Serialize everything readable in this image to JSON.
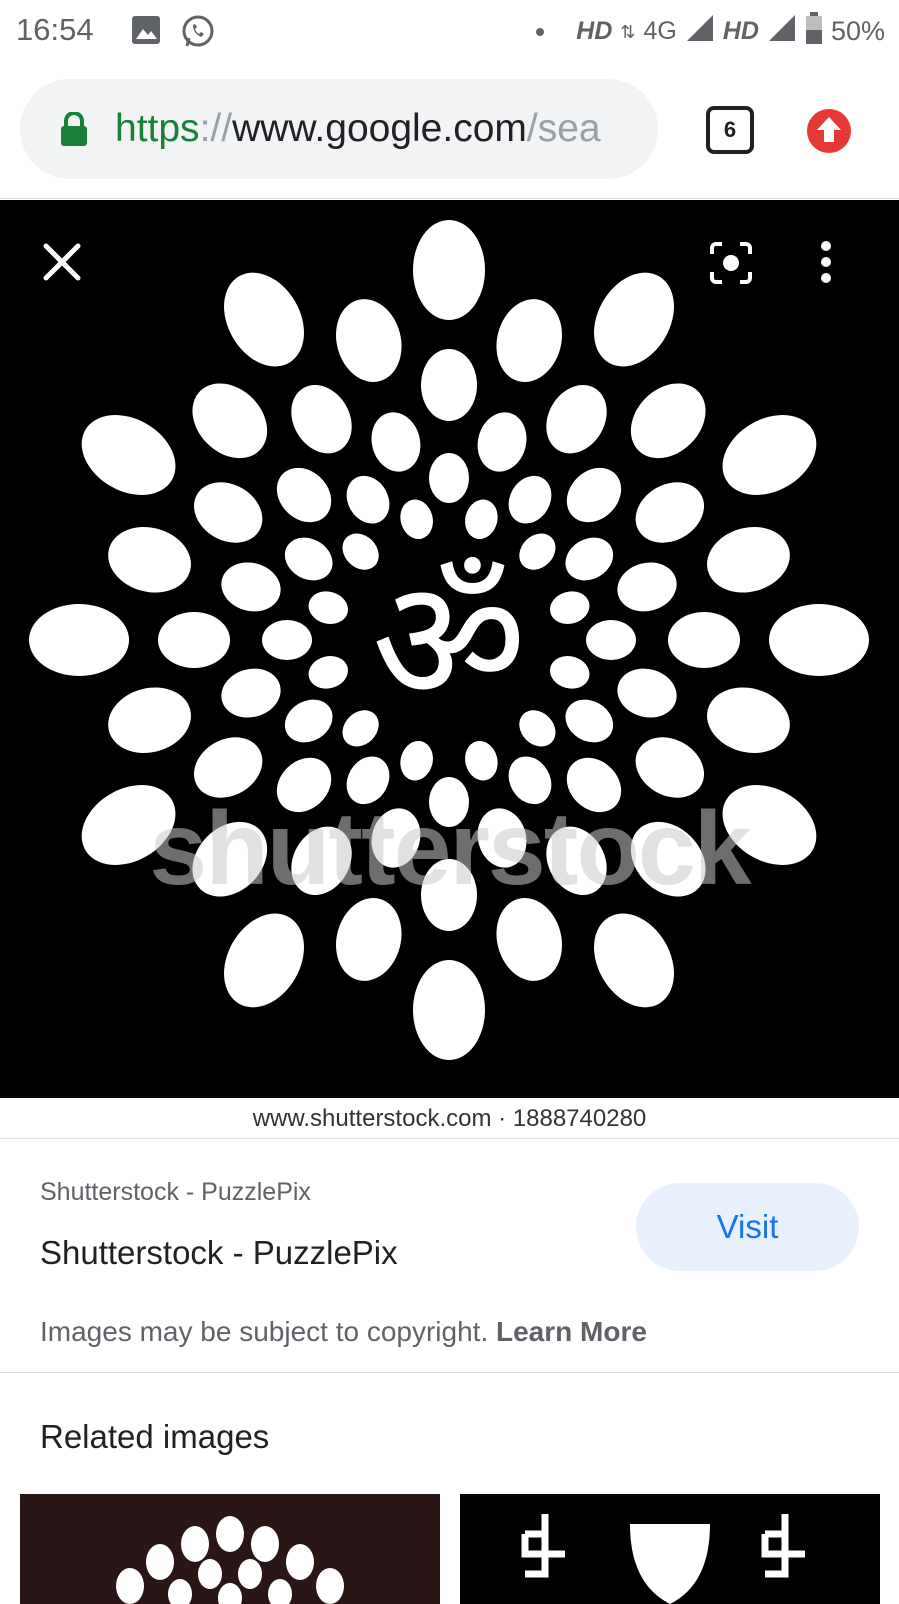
{
  "status_bar": {
    "time": "16:54",
    "network_1": "HD",
    "network_type": "4G",
    "network_2": "HD",
    "battery": "50%"
  },
  "browser": {
    "url_scheme": "https",
    "url_separator": "://",
    "url_host": "www.google.com",
    "url_path": "/sea",
    "tab_count": "6"
  },
  "viewer": {
    "watermark": "shutterstock",
    "caption": "www.shutterstock.com · 1888740280"
  },
  "result": {
    "source": "Shutterstock - PuzzlePix",
    "title": "Shutterstock - PuzzlePix",
    "visit_label": "Visit",
    "copyright_text": "Images may be subject to copyright.",
    "learn_more": "Learn More"
  },
  "related": {
    "title": "Related images"
  },
  "colors": {
    "accent": "#1a73e8",
    "visit_bg": "#e8f0fe",
    "secure_green": "#188038",
    "update_red": "#e53935"
  },
  "icons": [
    "gallery-icon",
    "whatsapp-icon",
    "signal-icon",
    "battery-icon",
    "lock-icon",
    "tab-switcher-icon",
    "update-icon",
    "close-icon",
    "lens-icon",
    "more-vert-icon"
  ]
}
